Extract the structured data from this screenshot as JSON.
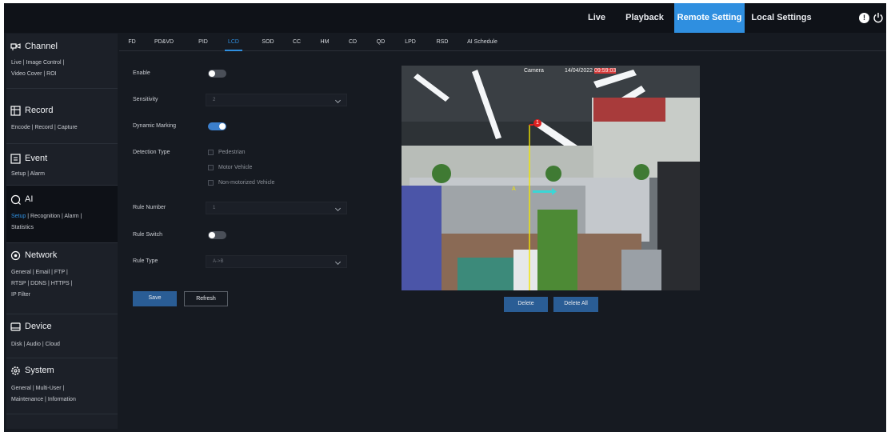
{
  "topbar": {
    "nav": [
      "Live",
      "Playback",
      "Remote Setting",
      "Local Settings"
    ],
    "active": "Remote Setting",
    "info_glyph": "!"
  },
  "sidebar": {
    "channel": {
      "title": "Channel",
      "links": [
        "Live",
        "Image Control",
        "Video Cover",
        "ROI"
      ]
    },
    "record": {
      "title": "Record",
      "links": [
        "Encode",
        "Record",
        "Capture"
      ]
    },
    "event": {
      "title": "Event",
      "links": [
        "Setup",
        "Alarm"
      ]
    },
    "ai": {
      "title": "AI",
      "links": [
        "Setup",
        "Recognition",
        "Alarm",
        "Statistics"
      ]
    },
    "network": {
      "title": "Network",
      "links": [
        "General",
        "Email",
        "FTP",
        "RTSP",
        "DDNS",
        "HTTPS",
        "IP Filter"
      ]
    },
    "device": {
      "title": "Device",
      "links": [
        "Disk",
        "Audio",
        "Cloud"
      ]
    },
    "system": {
      "title": "System",
      "links": [
        "General",
        "Multi-User",
        "Maintenance",
        "Information"
      ]
    },
    "sep": "|"
  },
  "tabs": [
    "FD",
    "PD&VD",
    "PID",
    "LCD",
    "SOD",
    "CC",
    "HM",
    "CD",
    "QD",
    "LPD",
    "RSD",
    "AI Schedule"
  ],
  "active_tab": "LCD",
  "form": {
    "enable_label": "Enable",
    "enable": false,
    "sensitivity_label": "Sensitivity",
    "sensitivity_value": "2",
    "dynamic_marking_label": "Dynamic Marking",
    "dynamic_marking": true,
    "detection_type_label": "Detection Type",
    "detection_options": [
      "Pedestrian",
      "Motor Vehicle",
      "Non-motorized Vehicle"
    ],
    "rule_number_label": "Rule Number",
    "rule_number_value": "1",
    "rule_switch_label": "Rule Switch",
    "rule_switch": false,
    "rule_type_label": "Rule Type",
    "rule_type_value": "A->B"
  },
  "buttons": {
    "save": "Save",
    "refresh": "Refresh",
    "delete": "Delete",
    "delete_all": "Delete All"
  },
  "camera": {
    "title": "Camera",
    "date": "14/04/2022",
    "time": "09:59:03",
    "rule_marker": "1",
    "point_a": "A"
  },
  "colors": {
    "accent": "#2f8fe0",
    "button": "#2a5d95",
    "rule_line": "#f2e600",
    "marker": "#e02020",
    "direction_arrow": "#3ad6d6"
  }
}
